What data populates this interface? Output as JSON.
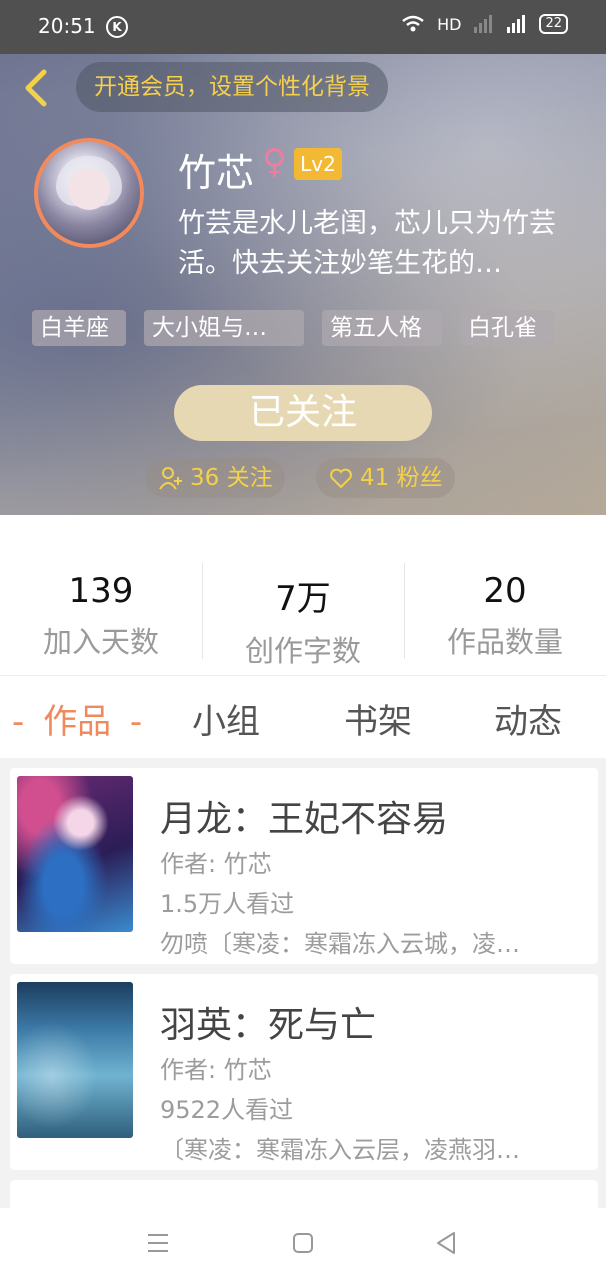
{
  "status_bar": {
    "time": "20:51",
    "network": "HD",
    "battery": "22"
  },
  "header": {
    "vip_prompt": "开通会员，设置个性化背景",
    "username": "竹芯",
    "gender_symbol": "♀",
    "level": "Lv2",
    "bio": "竹芸是水儿老闺，芯儿只为竹芸活。快去关注妙笔生花的…",
    "tags": [
      "白羊座",
      "大小姐与…",
      "第五人格",
      "白孔雀"
    ],
    "follow_button": "已关注",
    "following": "36 关注",
    "followers": "41 粉丝"
  },
  "stats": [
    {
      "value": "139",
      "label": "加入天数"
    },
    {
      "value": "7万",
      "label": "创作字数"
    },
    {
      "value": "20",
      "label": "作品数量"
    }
  ],
  "tabs": [
    "作品",
    "小组",
    "书架",
    "动态"
  ],
  "active_tab_decor": "-",
  "works": [
    {
      "title": "月龙：王妃不容易",
      "author": "作者: 竹芯",
      "views": "1.5万人看过",
      "desc": "勿喷〔寒凌：寒霜冻入云城，凌…"
    },
    {
      "title": "羽英：死与亡",
      "author": "作者: 竹芯",
      "views": "9522人看过",
      "desc": "〔寒凌：寒霜冻入云层，凌燕羽…"
    }
  ],
  "colors": {
    "accent": "#ef8a5e",
    "vip_text": "#f6d04d",
    "level_badge": "#f3b935"
  }
}
